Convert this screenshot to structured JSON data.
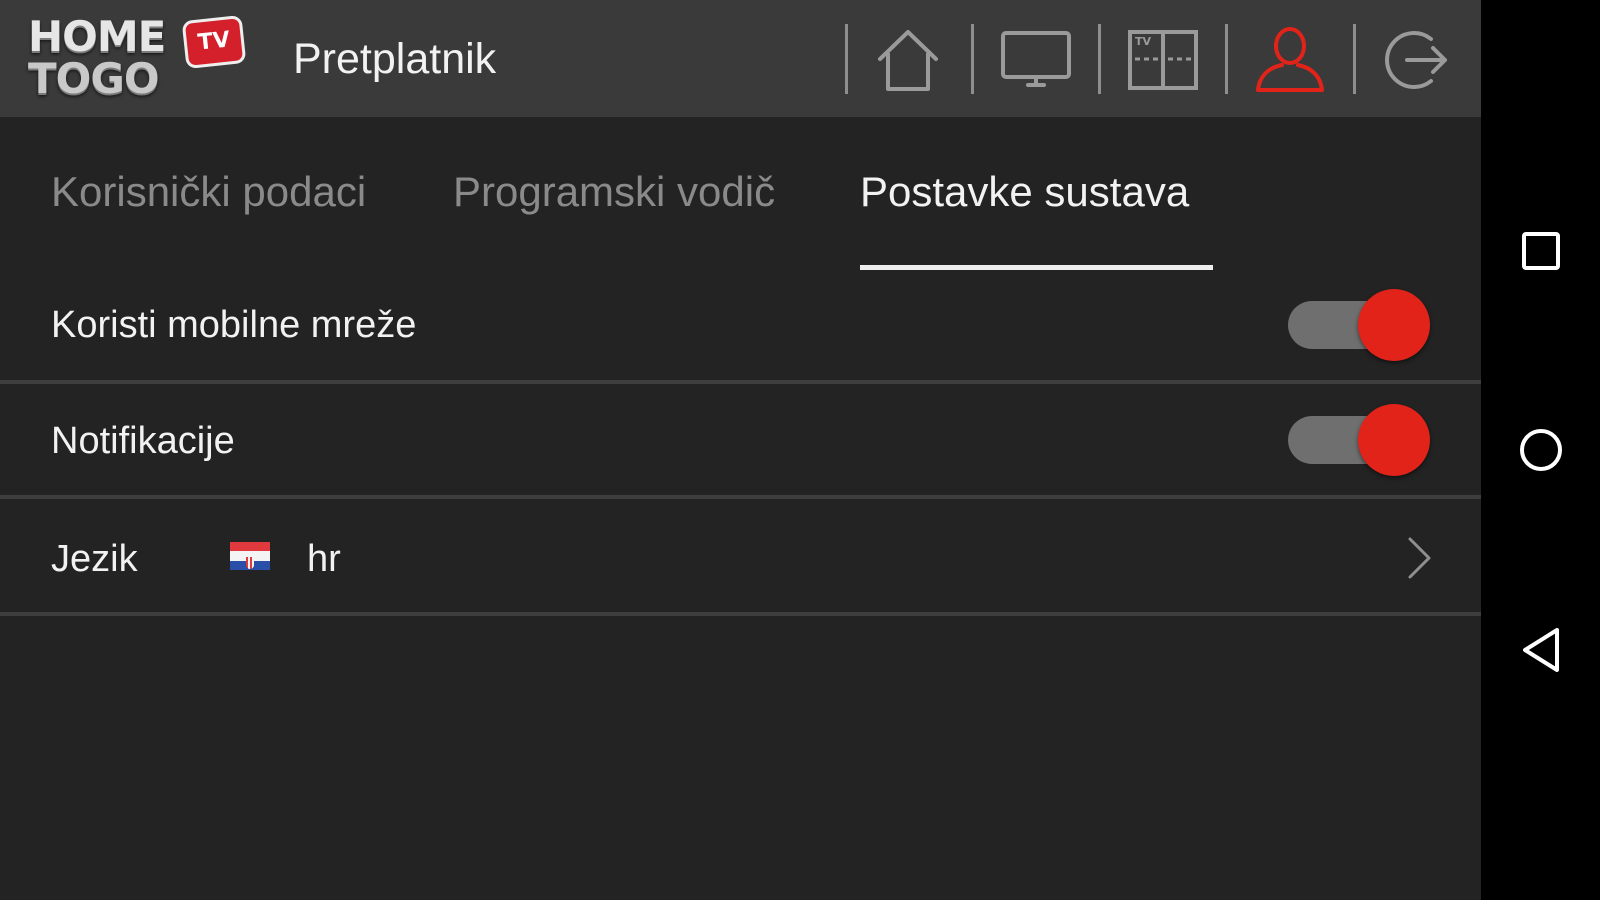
{
  "header": {
    "logo": {
      "line1": "HOME",
      "line2": "TOGO",
      "badge": "TV"
    },
    "title": "Pretplatnik",
    "nav_icons": [
      "home-icon",
      "tv-monitor-icon",
      "tv-guide-grid-icon",
      "user-profile-icon",
      "logout-icon"
    ],
    "active_nav": "user-profile-icon",
    "guide_icon_text": "TV"
  },
  "tabs": [
    {
      "label": "Korisnički podaci",
      "active": false
    },
    {
      "label": "Programski vodič",
      "active": false
    },
    {
      "label": "Postavke sustava",
      "active": true
    }
  ],
  "settings": {
    "mobile_networks": {
      "label": "Koristi mobilne mreže",
      "enabled": true
    },
    "notifications": {
      "label": "Notifikacije",
      "enabled": true
    },
    "language": {
      "label": "Jezik",
      "flag": "croatia-flag-icon",
      "value": "hr"
    }
  },
  "system_nav": [
    "recent-apps-icon",
    "home-circle-icon",
    "back-triangle-icon"
  ],
  "colors": {
    "accent": "#e2231a",
    "header_bg": "#3a3a3a",
    "content_bg": "#232323",
    "inactive_text": "#8a8a8a",
    "active_text": "#f2f2f2",
    "toggle_track": "#6f6f6f"
  }
}
